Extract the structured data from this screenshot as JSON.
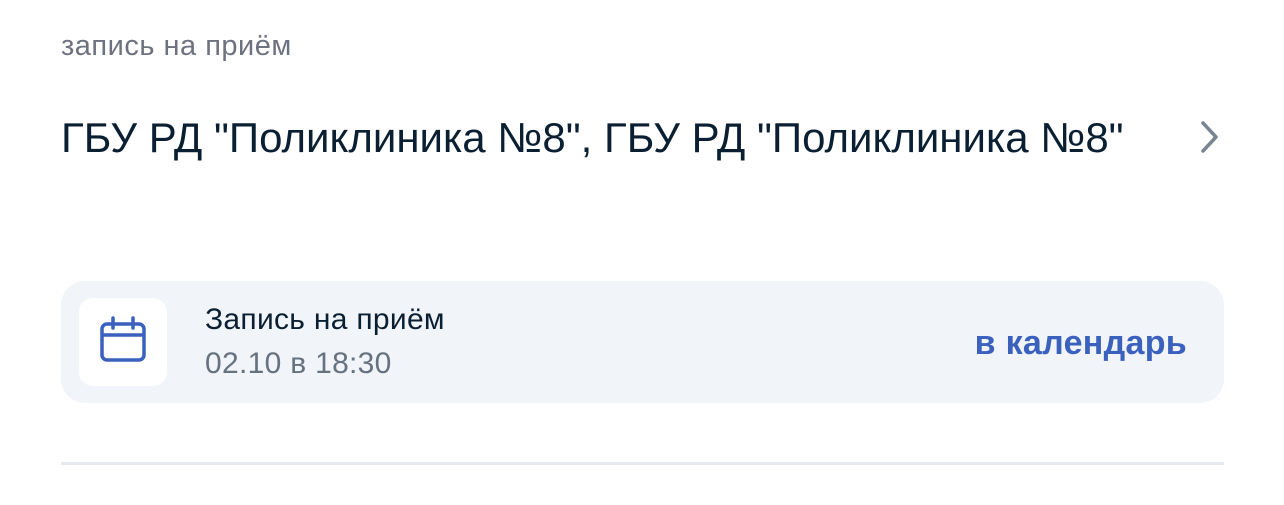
{
  "header": {
    "eyebrow": "запись на приём",
    "title": "ГБУ РД \"Поликлиника №8\", ГБУ РД \"Поликлиника №8\""
  },
  "appointment": {
    "title": "Запись на приём",
    "datetime": "02.10 в 18:30",
    "action_label": "в календарь",
    "icon": "calendar-icon"
  },
  "colors": {
    "accent": "#3a61bd",
    "card_bg": "#f1f4f8",
    "text_primary": "#0b1f33",
    "text_secondary": "#66727f"
  }
}
